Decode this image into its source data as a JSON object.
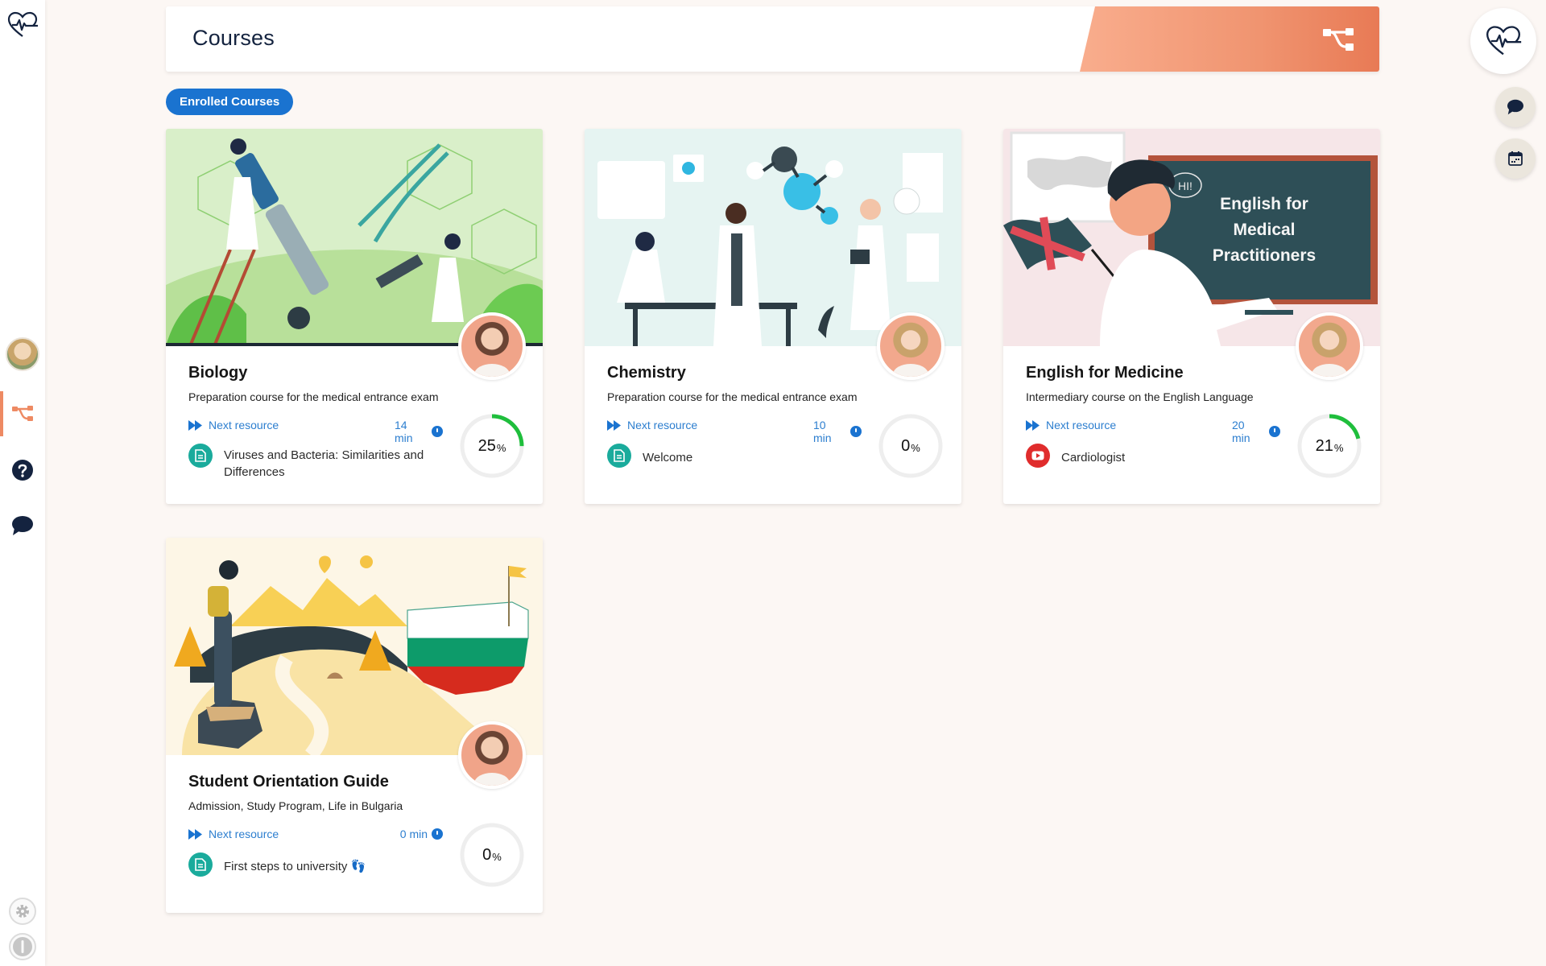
{
  "header": {
    "title": "Courses"
  },
  "filter": {
    "enrolled_label": "Enrolled Courses"
  },
  "colors": {
    "accent_orange": "#ee8a63",
    "primary_blue": "#1a73d0",
    "link_blue": "#2c7ecf",
    "navy": "#14233f",
    "progress_green": "#1fbe3c",
    "doc_teal": "#1aab9c",
    "video_red": "#e02c2c"
  },
  "sidebar": {
    "items": [
      {
        "name": "logo",
        "icon": "heart-pulse-icon"
      },
      {
        "name": "profile",
        "icon": "avatar"
      },
      {
        "name": "courses",
        "icon": "course-tree-icon",
        "active": true
      },
      {
        "name": "help",
        "icon": "help-icon"
      },
      {
        "name": "chat",
        "icon": "chat-icon"
      },
      {
        "name": "settings",
        "icon": "gear-icon"
      },
      {
        "name": "logout",
        "icon": "power-icon"
      }
    ]
  },
  "right_actions": [
    {
      "name": "health",
      "icon": "heart-pulse-icon"
    },
    {
      "name": "chat",
      "icon": "chat-icon"
    },
    {
      "name": "calendar",
      "icon": "calendar-icon"
    }
  ],
  "courses": [
    {
      "title": "Biology",
      "subtitle": "Preparation course for the medical entrance exam",
      "next_label": "Next resource",
      "duration": "14 min",
      "resource": "Viruses and Bacteria: Similarities and Differences",
      "resource_type": "document",
      "progress": 25,
      "progress_value": "25",
      "pct_sign": "%"
    },
    {
      "title": "Chemistry",
      "subtitle": "Preparation course for the medical entrance exam",
      "next_label": "Next resource",
      "duration": "10 min",
      "resource": "Welcome",
      "resource_type": "document",
      "progress": 0,
      "progress_value": "0",
      "pct_sign": "%"
    },
    {
      "title": "English for Medicine",
      "subtitle": "Intermediary course on the English Language",
      "next_label": "Next resource",
      "duration": "20 min",
      "resource": "Cardiologist",
      "resource_type": "video",
      "progress": 21,
      "progress_value": "21",
      "pct_sign": "%",
      "image_text": [
        "English for",
        "Medical",
        "Practitioners"
      ],
      "image_bubble": "HI!"
    },
    {
      "title": "Student Orientation Guide",
      "subtitle": "Admission, Study Program, Life in Bulgaria",
      "next_label": "Next resource",
      "duration": "0 min",
      "resource": "First steps to university 👣",
      "resource_type": "document",
      "progress": 0,
      "progress_value": "0",
      "pct_sign": "%"
    }
  ]
}
